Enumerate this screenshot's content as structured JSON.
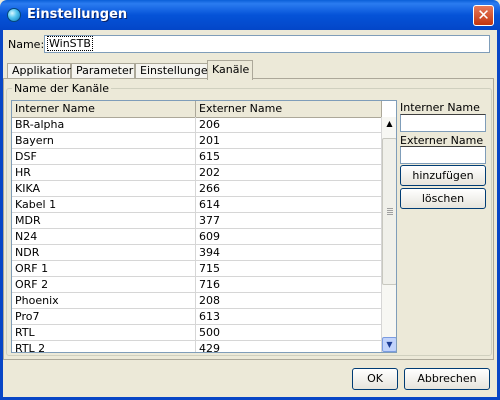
{
  "window": {
    "title": "Einstellungen",
    "close_glyph": "✕"
  },
  "name_field": {
    "label": "Name:",
    "value": "WinSTB"
  },
  "tabs": [
    {
      "label": "Applikation"
    },
    {
      "label": "Parameter"
    },
    {
      "label": "Einstellungen"
    },
    {
      "label": "Kanäle"
    }
  ],
  "active_tab": "Kanäle",
  "channels_group": {
    "title": "Name der Kanäle"
  },
  "table": {
    "columns": [
      "Interner Name",
      "Externer Name"
    ],
    "rows": [
      [
        "BR-alpha",
        "206"
      ],
      [
        "Bayern",
        "201"
      ],
      [
        "DSF",
        "615"
      ],
      [
        "HR",
        "202"
      ],
      [
        "KIKA",
        "266"
      ],
      [
        "Kabel 1",
        "614"
      ],
      [
        "MDR",
        "377"
      ],
      [
        "N24",
        "609"
      ],
      [
        "NDR",
        "394"
      ],
      [
        "ORF 1",
        "715"
      ],
      [
        "ORF 2",
        "716"
      ],
      [
        "Phoenix",
        "208"
      ],
      [
        "Pro7",
        "613"
      ],
      [
        "RTL",
        "500"
      ],
      [
        "RTL 2",
        "429"
      ]
    ]
  },
  "scrollbar": {
    "up_glyph": "▲",
    "down_glyph": "▼"
  },
  "side_panel": {
    "internal_label": "Interner Name",
    "internal_value": "",
    "external_label": "Externer Name",
    "external_value": "",
    "add_label": "hinzufügen",
    "delete_label": "löschen"
  },
  "footer": {
    "ok_label": "OK",
    "cancel_label": "Abbrechen"
  }
}
